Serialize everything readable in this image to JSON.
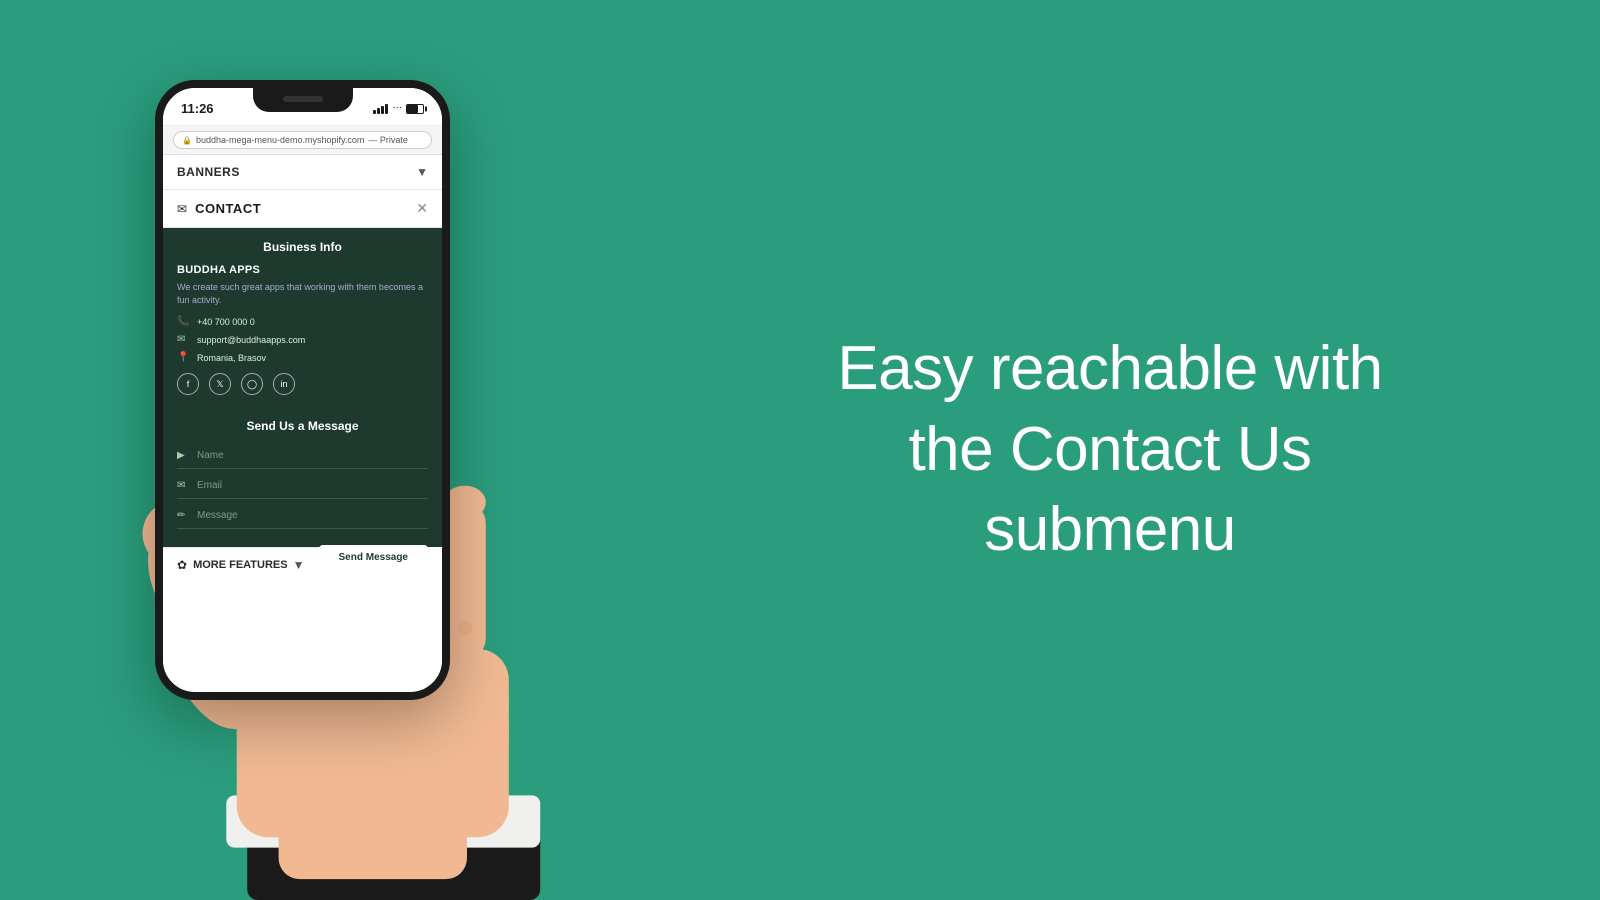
{
  "background_color": "#2a9d7c",
  "phone": {
    "time": "11:26",
    "url": "buddha-mega-menu-demo.myshopify.com",
    "url_suffix": "— Private",
    "banners_label": "BANNERS",
    "contact_label": "CONTACT",
    "business_info_title": "Business Info",
    "company_name": "BUDDHA APPS",
    "company_desc": "We create such great apps that working with them becomes a fun activity.",
    "phone_number": "+40 700 000 0",
    "email": "support@buddhaapps.com",
    "location": "Romania, Brasov",
    "send_message_title": "Send Us a Message",
    "name_placeholder": "Name",
    "email_placeholder": "Email",
    "message_placeholder": "Message",
    "send_button_label": "Send Message",
    "more_features_label": "MORE FEATURES"
  },
  "tagline": {
    "line1": "Easy reachable with",
    "line2": "the Contact Us",
    "line3": "submenu"
  }
}
